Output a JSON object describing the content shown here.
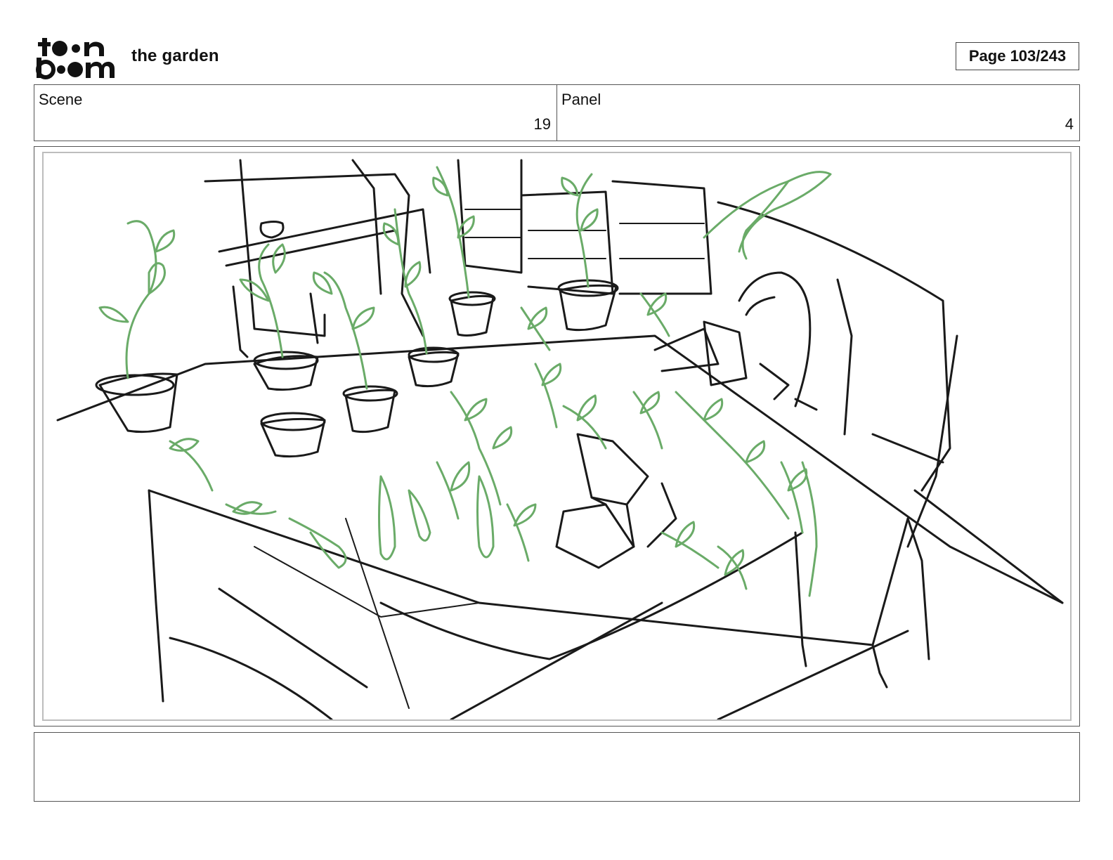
{
  "header": {
    "logo_text": "toon boom",
    "project_title": "the garden",
    "page_label": "Page 103/243"
  },
  "info": {
    "scene_label": "Scene",
    "scene_value": "19",
    "panel_label": "Panel",
    "panel_value": "4"
  },
  "drawing": {
    "description_colors": {
      "ink": "#1a1a1a",
      "plants": "#6aab68",
      "frame": "#bdbdbd"
    }
  },
  "notes": {
    "text": ""
  }
}
